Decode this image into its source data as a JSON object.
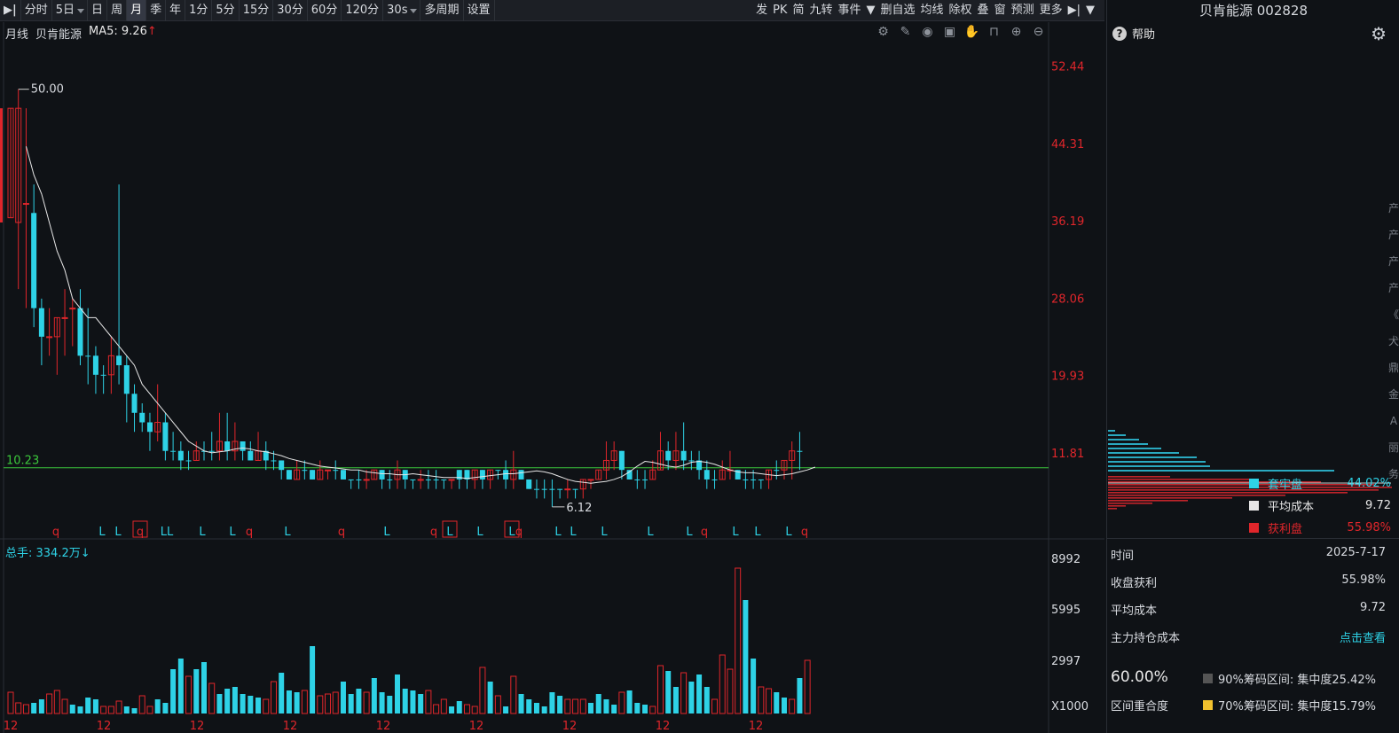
{
  "toolbar": {
    "items": [
      {
        "label": "分时",
        "active": false,
        "drop": false
      },
      {
        "label": "5日",
        "active": false,
        "drop": true
      },
      {
        "label": "日",
        "active": false,
        "drop": false
      },
      {
        "label": "周",
        "active": false,
        "drop": false
      },
      {
        "label": "月",
        "active": true,
        "drop": false
      },
      {
        "label": "季",
        "active": false,
        "drop": false
      },
      {
        "label": "年",
        "active": false,
        "drop": false
      },
      {
        "label": "1分",
        "active": false,
        "drop": false
      },
      {
        "label": "5分",
        "active": false,
        "drop": false
      },
      {
        "label": "15分",
        "active": false,
        "drop": false
      },
      {
        "label": "30分",
        "active": false,
        "drop": false
      },
      {
        "label": "60分",
        "active": false,
        "drop": false
      },
      {
        "label": "120分",
        "active": false,
        "drop": false
      },
      {
        "label": "30s",
        "active": false,
        "drop": true
      },
      {
        "label": "多周期",
        "active": false,
        "drop": false
      },
      {
        "label": "设置",
        "active": false,
        "drop": false
      }
    ],
    "right_items": [
      "发",
      "PK",
      "简",
      "九转",
      "事件",
      "▼",
      "删自选",
      "均线",
      "除权",
      "叠",
      "窗",
      "预测",
      "更多",
      "▶|",
      "▼"
    ]
  },
  "chart": {
    "legend_period": "月线",
    "legend_name": "贝肯能源",
    "legend_ma": "MA5: 9.26",
    "legend_ma_arrow": "↑",
    "price_axis": [
      "52.44",
      "44.31",
      "36.19",
      "28.06",
      "19.93",
      "11.81"
    ],
    "hline_value": 10.23,
    "hline_label": "10.23",
    "high_label": "50.00",
    "low_label": "6.12",
    "signals": [
      {
        "x": 63,
        "t": "q",
        "box": false
      },
      {
        "x": 115,
        "t": "L",
        "box": false
      },
      {
        "x": 133,
        "t": "L",
        "box": false
      },
      {
        "x": 158,
        "t": "q",
        "box": true
      },
      {
        "x": 188,
        "t": "LL",
        "box": false
      },
      {
        "x": 228,
        "t": "L",
        "box": false
      },
      {
        "x": 262,
        "t": "L",
        "box": false
      },
      {
        "x": 281,
        "t": "q",
        "box": false
      },
      {
        "x": 324,
        "t": "L",
        "box": false
      },
      {
        "x": 385,
        "t": "q",
        "box": false
      },
      {
        "x": 436,
        "t": "L",
        "box": false
      },
      {
        "x": 489,
        "t": "q",
        "box": false
      },
      {
        "x": 507,
        "t": "L",
        "box": true
      },
      {
        "x": 541,
        "t": "L",
        "box": false
      },
      {
        "x": 577,
        "t": "L",
        "box": true
      },
      {
        "x": 585,
        "t": "q",
        "box": false
      },
      {
        "x": 629,
        "t": "L",
        "box": false
      },
      {
        "x": 646,
        "t": "L",
        "box": false
      },
      {
        "x": 681,
        "t": "L",
        "box": false
      },
      {
        "x": 733,
        "t": "L",
        "box": false
      },
      {
        "x": 777,
        "t": "L",
        "box": false
      },
      {
        "x": 794,
        "t": "q",
        "box": false
      },
      {
        "x": 829,
        "t": "L",
        "box": false
      },
      {
        "x": 854,
        "t": "L",
        "box": false
      },
      {
        "x": 889,
        "t": "L",
        "box": false
      },
      {
        "x": 907,
        "t": "q",
        "box": false
      }
    ],
    "xaxis_labels": [
      "12",
      "12",
      "12",
      "12",
      "12",
      "12",
      "12",
      "12",
      "12"
    ],
    "vol_legend": "总手: 334.2万",
    "vol_legend_arrow": "↓",
    "vol_axis": [
      "8992",
      "5995",
      "2997",
      "X1000"
    ]
  },
  "chart_data": {
    "type": "candlestick",
    "y_range": [
      3.5,
      55
    ],
    "candles": [
      [
        48,
        36.5,
        36.5,
        48,
        "red"
      ],
      [
        36,
        48,
        29,
        50,
        "red"
      ],
      [
        38,
        38,
        27,
        48,
        "red"
      ],
      [
        37,
        27,
        25,
        40,
        "blue"
      ],
      [
        27,
        24,
        21,
        28,
        "blue"
      ],
      [
        24,
        24,
        22,
        27,
        "red"
      ],
      [
        24,
        26,
        20,
        26,
        "red"
      ],
      [
        26,
        26,
        22,
        29,
        "red"
      ],
      [
        27,
        27,
        23,
        28,
        "red"
      ],
      [
        27,
        22,
        21,
        29,
        "blue"
      ],
      [
        22,
        22,
        19,
        27,
        "blue"
      ],
      [
        22,
        20,
        18,
        23,
        "blue"
      ],
      [
        20,
        20,
        18,
        21,
        "blue"
      ],
      [
        20,
        22,
        18,
        24,
        "red"
      ],
      [
        22,
        21,
        19,
        40,
        "blue"
      ],
      [
        21,
        18,
        15,
        22,
        "blue"
      ],
      [
        18,
        16,
        14,
        19,
        "blue"
      ],
      [
        16,
        15,
        14,
        17,
        "blue"
      ],
      [
        15,
        14,
        12,
        16,
        "blue"
      ],
      [
        14,
        15,
        13,
        19,
        "red"
      ],
      [
        15,
        12,
        11,
        16,
        "blue"
      ],
      [
        12,
        12,
        11,
        14,
        "blue"
      ],
      [
        12,
        11,
        10,
        13,
        "blue"
      ],
      [
        11,
        11,
        10,
        12,
        "blue"
      ],
      [
        11,
        12,
        11,
        13,
        "red"
      ],
      [
        12,
        12,
        11,
        13,
        "blue"
      ],
      [
        12,
        12,
        11,
        14,
        "blue"
      ],
      [
        12,
        13,
        11,
        16,
        "red"
      ],
      [
        13,
        12,
        11,
        16,
        "blue"
      ],
      [
        12,
        13,
        11,
        15,
        "red"
      ],
      [
        13,
        12,
        11,
        13,
        "blue"
      ],
      [
        12,
        11,
        11,
        13,
        "blue"
      ],
      [
        11,
        12,
        11,
        14,
        "red"
      ],
      [
        12,
        11,
        10,
        13,
        "blue"
      ],
      [
        11,
        11,
        10,
        12,
        "blue"
      ],
      [
        11,
        10,
        9,
        11,
        "blue"
      ],
      [
        10,
        9,
        9,
        10,
        "blue"
      ],
      [
        9,
        10,
        9,
        11,
        "red"
      ],
      [
        10,
        10,
        9,
        11,
        "blue"
      ],
      [
        10,
        9,
        9,
        10,
        "blue"
      ],
      [
        9,
        10,
        9,
        11,
        "red"
      ],
      [
        10,
        10,
        9,
        10,
        "red"
      ],
      [
        10,
        10,
        9,
        11,
        "blue"
      ],
      [
        10,
        9,
        9,
        10,
        "blue"
      ],
      [
        9,
        9,
        8,
        9,
        "blue"
      ],
      [
        9,
        9,
        8,
        10,
        "blue"
      ],
      [
        9,
        9,
        8,
        10,
        "red"
      ],
      [
        9,
        10,
        9,
        10,
        "red"
      ],
      [
        10,
        9,
        8,
        10,
        "blue"
      ],
      [
        9,
        9,
        8,
        10,
        "blue"
      ],
      [
        9,
        10,
        8,
        11,
        "red"
      ],
      [
        10,
        9,
        8,
        10,
        "blue"
      ],
      [
        9,
        9,
        8,
        9,
        "blue"
      ],
      [
        9,
        9,
        8,
        10,
        "red"
      ],
      [
        9,
        9,
        8,
        10,
        "blue"
      ],
      [
        9,
        9,
        8,
        10,
        "blue"
      ],
      [
        9,
        9,
        8,
        9,
        "blue"
      ],
      [
        9,
        9,
        8,
        9,
        "red"
      ],
      [
        9,
        10,
        8,
        10,
        "blue"
      ],
      [
        10,
        9,
        8,
        10,
        "blue"
      ],
      [
        9,
        10,
        8,
        10,
        "red"
      ],
      [
        10,
        9,
        8,
        10,
        "blue"
      ],
      [
        9,
        10,
        8,
        10,
        "red"
      ],
      [
        10,
        10,
        9,
        10,
        "blue"
      ],
      [
        10,
        9,
        8,
        11,
        "blue"
      ],
      [
        9,
        10,
        8,
        12,
        "red"
      ],
      [
        10,
        9,
        9,
        10,
        "blue"
      ],
      [
        9,
        8,
        8,
        9,
        "blue"
      ],
      [
        8,
        8,
        7,
        9,
        "blue"
      ],
      [
        8,
        8,
        7,
        9,
        "blue"
      ],
      [
        8,
        8,
        6.12,
        9,
        "blue"
      ],
      [
        8,
        8,
        7,
        8,
        "blue"
      ],
      [
        8,
        8,
        7,
        9,
        "red"
      ],
      [
        8,
        8,
        7,
        8,
        "blue"
      ],
      [
        8,
        9,
        7,
        9,
        "red"
      ],
      [
        9,
        9,
        8,
        9,
        "red"
      ],
      [
        9,
        10,
        9,
        10,
        "red"
      ],
      [
        10,
        11,
        9,
        13,
        "red"
      ],
      [
        11,
        12,
        10,
        13,
        "red"
      ],
      [
        12,
        10,
        9,
        12,
        "blue"
      ],
      [
        10,
        9,
        9,
        10,
        "blue"
      ],
      [
        9,
        9,
        8,
        10,
        "blue"
      ],
      [
        9,
        9,
        8,
        10,
        "blue"
      ],
      [
        9,
        10,
        9,
        11,
        "red"
      ],
      [
        10,
        12,
        10,
        14,
        "red"
      ],
      [
        12,
        11,
        10,
        13,
        "blue"
      ],
      [
        11,
        12,
        10,
        14,
        "red"
      ],
      [
        12,
        11,
        10,
        15,
        "blue"
      ],
      [
        11,
        11,
        10,
        12,
        "blue"
      ],
      [
        11,
        10,
        9,
        12,
        "blue"
      ],
      [
        10,
        9,
        8,
        11,
        "blue"
      ],
      [
        9,
        9,
        8,
        10,
        "blue"
      ],
      [
        9,
        10,
        9,
        11,
        "red"
      ],
      [
        10,
        10,
        9,
        12,
        "red"
      ],
      [
        10,
        9,
        9,
        10,
        "blue"
      ],
      [
        9,
        9,
        8,
        10,
        "blue"
      ],
      [
        9,
        9,
        8,
        10,
        "blue"
      ],
      [
        9,
        9,
        8,
        9,
        "blue"
      ],
      [
        9,
        10,
        8,
        10,
        "red"
      ],
      [
        10,
        10,
        9,
        11,
        "blue"
      ],
      [
        10,
        11,
        9,
        11,
        "red"
      ],
      [
        11,
        12,
        9,
        13,
        "red"
      ],
      [
        12,
        12,
        10,
        14,
        "blue"
      ]
    ],
    "ma5": [
      44,
      41,
      39,
      36,
      33,
      31,
      28,
      27,
      26,
      26,
      25,
      24,
      23,
      22,
      21,
      19,
      18,
      17,
      16,
      15,
      14,
      13,
      12.5,
      12,
      11.8,
      11.9,
      12,
      12.2,
      12.3,
      12.2,
      12,
      11.9,
      11.7,
      11.5,
      11.2,
      11,
      10.8,
      10.6,
      10.4,
      10.3,
      10.2,
      10.1,
      10,
      10,
      9.8,
      9.7,
      9.6,
      9.6,
      9.5,
      9.5,
      9.6,
      9.5,
      9.4,
      9.3,
      9.2,
      9.2,
      9.2,
      9.1,
      9.2,
      9.3,
      9.4,
      9.5,
      9.6,
      9.6,
      9.7,
      9.8,
      9.9,
      9.8,
      9.6,
      9.3,
      9,
      8.8,
      8.7,
      8.6,
      8.7,
      8.8,
      9,
      9.3,
      9.8,
      10.4,
      10.9,
      10.8,
      10.6,
      10.4,
      10.3,
      10.5,
      10.8,
      10.9,
      10.8,
      10.6,
      10.3,
      10,
      9.8,
      9.7,
      9.7,
      9.6,
      9.5,
      9.4,
      9.5,
      9.6,
      9.8,
      10,
      10.3
    ],
    "volume": [
      [
        12,
        "red"
      ],
      [
        6,
        "red"
      ],
      [
        5,
        "red"
      ],
      [
        6,
        "blue"
      ],
      [
        8,
        "blue"
      ],
      [
        11,
        "red"
      ],
      [
        13,
        "red"
      ],
      [
        8,
        "red"
      ],
      [
        5,
        "blue"
      ],
      [
        4,
        "blue"
      ],
      [
        9,
        "blue"
      ],
      [
        8,
        "blue"
      ],
      [
        4,
        "red"
      ],
      [
        4,
        "red"
      ],
      [
        7,
        "red"
      ],
      [
        4,
        "blue"
      ],
      [
        3,
        "blue"
      ],
      [
        10,
        "red"
      ],
      [
        4,
        "red"
      ],
      [
        8,
        "blue"
      ],
      [
        6,
        "blue"
      ],
      [
        25,
        "blue"
      ],
      [
        31,
        "blue"
      ],
      [
        21,
        "red"
      ],
      [
        25,
        "blue"
      ],
      [
        29,
        "blue"
      ],
      [
        17,
        "red"
      ],
      [
        11,
        "blue"
      ],
      [
        14,
        "blue"
      ],
      [
        15,
        "blue"
      ],
      [
        11,
        "blue"
      ],
      [
        10,
        "blue"
      ],
      [
        9,
        "blue"
      ],
      [
        8,
        "red"
      ],
      [
        18,
        "red"
      ],
      [
        23,
        "blue"
      ],
      [
        13,
        "blue"
      ],
      [
        12,
        "blue"
      ],
      [
        13,
        "red"
      ],
      [
        38,
        "blue"
      ],
      [
        10,
        "red"
      ],
      [
        11,
        "red"
      ],
      [
        12,
        "red"
      ],
      [
        18,
        "blue"
      ],
      [
        11,
        "blue"
      ],
      [
        14,
        "blue"
      ],
      [
        12,
        "red"
      ],
      [
        20,
        "blue"
      ],
      [
        12,
        "blue"
      ],
      [
        10,
        "blue"
      ],
      [
        22,
        "blue"
      ],
      [
        14,
        "blue"
      ],
      [
        13,
        "blue"
      ],
      [
        11,
        "blue"
      ],
      [
        13,
        "red"
      ],
      [
        5,
        "red"
      ],
      [
        8,
        "red"
      ],
      [
        4,
        "blue"
      ],
      [
        7,
        "blue"
      ],
      [
        5,
        "red"
      ],
      [
        4,
        "red"
      ],
      [
        26,
        "red"
      ],
      [
        18,
        "blue"
      ],
      [
        10,
        "red"
      ],
      [
        4,
        "blue"
      ],
      [
        21,
        "red"
      ],
      [
        11,
        "blue"
      ],
      [
        8,
        "blue"
      ],
      [
        6,
        "blue"
      ],
      [
        4,
        "blue"
      ],
      [
        12,
        "blue"
      ],
      [
        10,
        "blue"
      ],
      [
        8,
        "red"
      ],
      [
        8,
        "red"
      ],
      [
        8,
        "red"
      ],
      [
        6,
        "blue"
      ],
      [
        11,
        "blue"
      ],
      [
        8,
        "blue"
      ],
      [
        5,
        "blue"
      ],
      [
        12,
        "red"
      ],
      [
        13,
        "blue"
      ],
      [
        6,
        "blue"
      ],
      [
        5,
        "blue"
      ],
      [
        4,
        "red"
      ],
      [
        27,
        "red"
      ],
      [
        24,
        "blue"
      ],
      [
        15,
        "blue"
      ],
      [
        23,
        "red"
      ],
      [
        18,
        "blue"
      ],
      [
        22,
        "blue"
      ],
      [
        15,
        "blue"
      ],
      [
        8,
        "red"
      ],
      [
        33,
        "red"
      ],
      [
        25,
        "red"
      ],
      [
        82,
        "red"
      ],
      [
        64,
        "blue"
      ],
      [
        31,
        "blue"
      ],
      [
        15,
        "red"
      ],
      [
        14,
        "red"
      ],
      [
        12,
        "blue"
      ],
      [
        9,
        "blue"
      ],
      [
        8,
        "red"
      ],
      [
        20,
        "blue"
      ],
      [
        30,
        "red"
      ]
    ]
  },
  "right_panel": {
    "title": "贝肯能源 002828",
    "help_label": "帮助",
    "legend": [
      {
        "label": "套牢盘",
        "value": "44.02%",
        "color": "#2ed2e6"
      },
      {
        "label": "平均成本",
        "value": "9.72",
        "color": "#e6e6e6"
      },
      {
        "label": "获利盘",
        "value": "55.98%",
        "color": "#e0262b"
      }
    ],
    "info": {
      "time_label": "时间",
      "time_value": "2025-7-17",
      "profit_label": "收盘获利",
      "profit_value": "55.98%",
      "avg_label": "平均成本",
      "avg_value": "9.72",
      "main_label": "主力持仓成本",
      "main_value": "点击查看",
      "pct": "60.00%",
      "overlap_label": "区间重合度",
      "c90": "90%筹码区间: 集中度25.42%",
      "c70": "70%筹码区间: 集中度15.79%"
    },
    "edge_glyphs": [
      "产",
      "产",
      "产",
      "产",
      "《",
      "犬",
      "鼎",
      "金",
      "A",
      "丽",
      "务"
    ]
  }
}
